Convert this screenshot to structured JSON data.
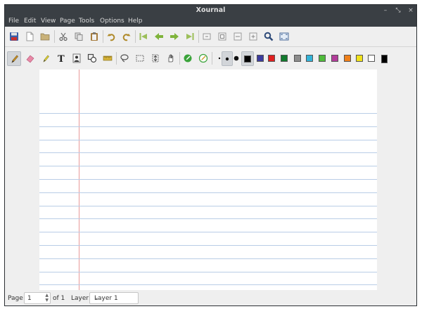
{
  "window": {
    "title": "Xournal"
  },
  "window_controls": {
    "minimize": "–",
    "restore": "⤡",
    "close": "×"
  },
  "menu": [
    "File",
    "Edit",
    "View",
    "Page",
    "Tools",
    "Options",
    "Help"
  ],
  "toolbar1_icons": [
    "save-icon",
    "new-document-icon",
    "open-folder-icon",
    "cut-icon",
    "copy-icon",
    "paste-icon",
    "undo-icon",
    "redo-icon",
    "first-page-icon",
    "previous-page-icon",
    "next-page-icon",
    "last-page-icon",
    "zoom-out-icon",
    "zoom-100-icon",
    "zoom-fit-width-icon",
    "zoom-in-icon",
    "find-icon",
    "fullscreen-icon"
  ],
  "toolbar2_tools": [
    "pen-icon",
    "eraser-icon",
    "highlighter-icon",
    "text-icon",
    "image-icon",
    "shape-recognizer-icon",
    "ruler-icon",
    "lasso-icon",
    "rect-select-icon",
    "vertical-space-icon",
    "hand-icon",
    "default-pen-icon",
    "default-highlighter-icon"
  ],
  "thickness": [
    "thin",
    "medium",
    "thick"
  ],
  "colors": [
    "#000000",
    "#3c3c9e",
    "#e02020",
    "#127a2e",
    "#8c8c8c",
    "#33b3d8",
    "#4fbb3b",
    "#b23d9a",
    "#f0801a",
    "#f0e21a",
    "#ffffff",
    "#000000"
  ],
  "status": {
    "page_label": "Page",
    "page_value": "1",
    "of_label": "of 1",
    "layer_label": "Layer:",
    "layer_value": "Layer 1"
  },
  "paper": {
    "style": "lined",
    "rule_color": "#b9cde6",
    "margin_color": "#e89a9a"
  }
}
